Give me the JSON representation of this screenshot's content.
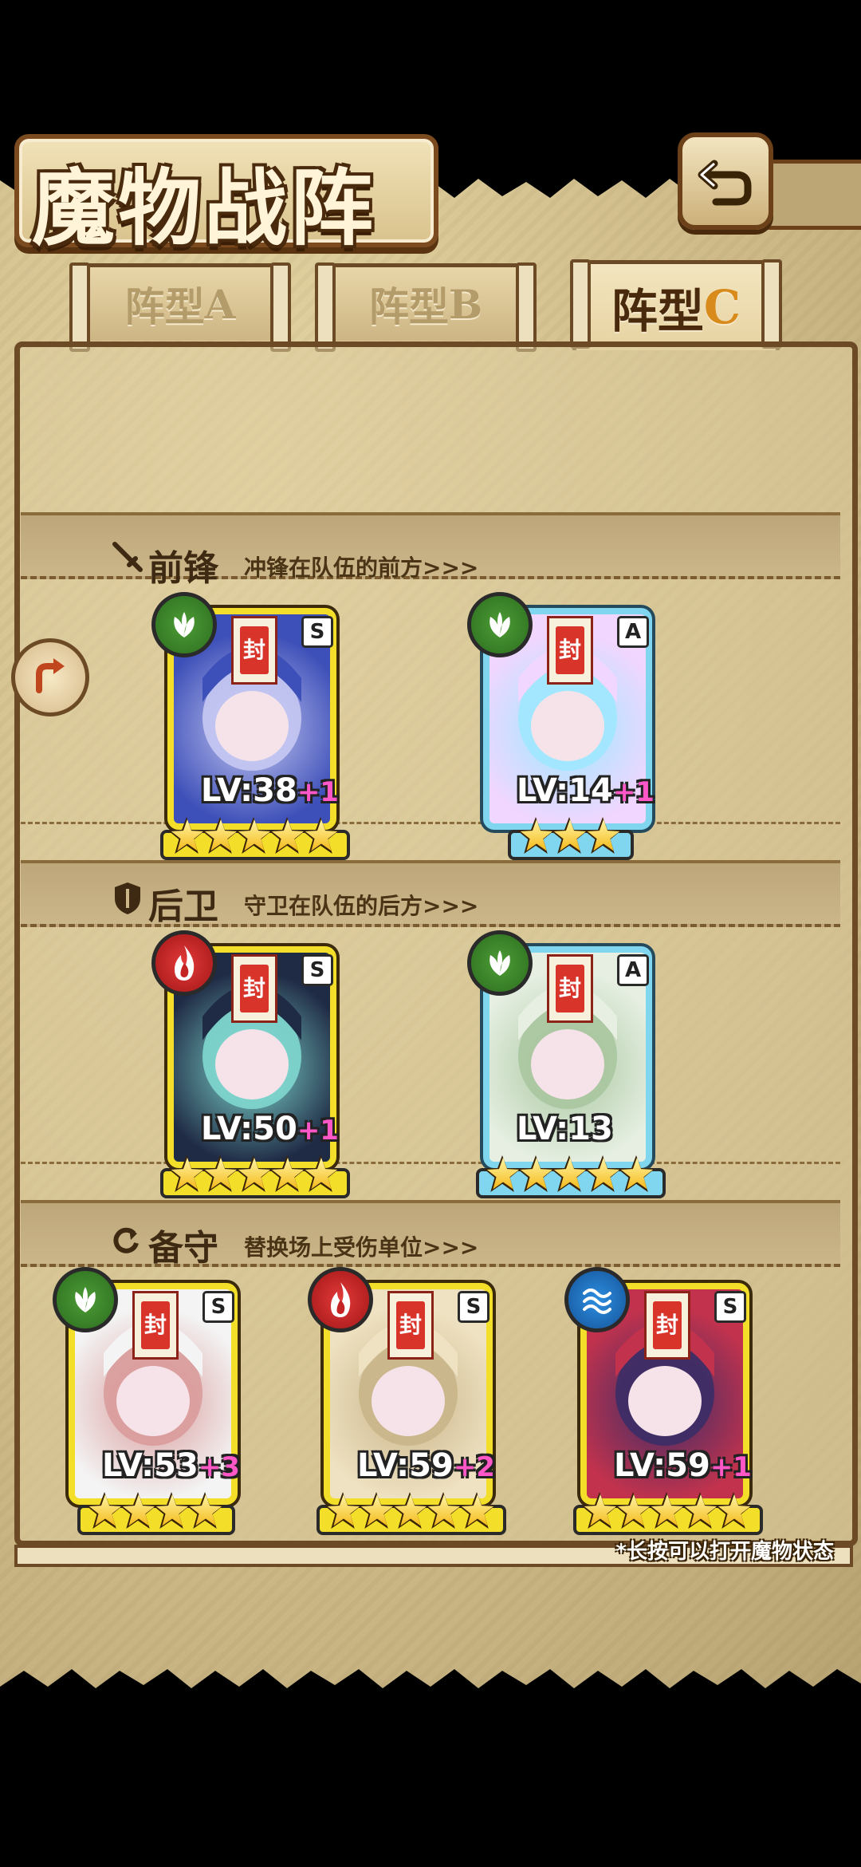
{
  "screen": {
    "title": "魔物战阵"
  },
  "tabs": [
    {
      "label_main": "阵型",
      "label_letter": "A",
      "active": false
    },
    {
      "label_main": "阵型",
      "label_letter": "B",
      "active": false
    },
    {
      "label_main": "阵型",
      "label_letter": "C",
      "active": true
    }
  ],
  "sections": {
    "front": {
      "title": "前锋",
      "desc": "冲锋在队伍的前方>>>"
    },
    "rear": {
      "title": "后卫",
      "desc": "守卫在队伍的后方>>>"
    },
    "reserve": {
      "title": "备守",
      "desc": "替换场上受伤单位>>>"
    }
  },
  "units": [
    {
      "id": "u1",
      "rank": "S",
      "element": "grass",
      "level": "LV:38",
      "plus": "+1",
      "stars": 5
    },
    {
      "id": "u2",
      "rank": "A",
      "element": "grass",
      "level": "LV:14",
      "plus": "+1",
      "stars": 3
    },
    {
      "id": "u3",
      "rank": "S",
      "element": "fire",
      "level": "LV:50",
      "plus": "+1",
      "stars": 5
    },
    {
      "id": "u4",
      "rank": "A",
      "element": "grass",
      "level": "LV:13",
      "plus": "",
      "stars": 5
    },
    {
      "id": "u5",
      "rank": "S",
      "element": "grass",
      "level": "LV:53",
      "plus": "+3",
      "stars": 4
    },
    {
      "id": "u6",
      "rank": "S",
      "element": "fire",
      "level": "LV:59",
      "plus": "+2",
      "stars": 5
    },
    {
      "id": "u7",
      "rank": "S",
      "element": "water",
      "level": "LV:59",
      "plus": "+1",
      "stars": 5
    }
  ],
  "hint": "*长按可以打开魔物状态",
  "seal_char": "封",
  "colors": {
    "rank_s": "#f3df2a",
    "rank_a": "#7fd6ee",
    "grass": "#3b8a2a",
    "fire": "#c42424",
    "water": "#1f74c6"
  },
  "icons": {
    "back": "return-arrow-icon",
    "side": "rotate-arrow-icon"
  }
}
